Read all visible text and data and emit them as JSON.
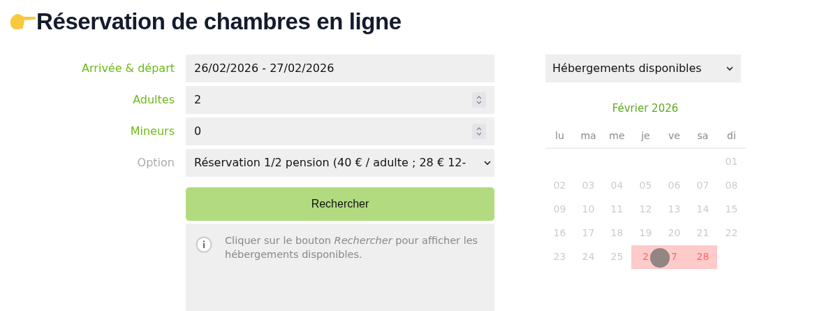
{
  "title": "Réservation de chambres en ligne",
  "form": {
    "fields": [
      {
        "label": "Arrivée & départ",
        "kind": "text",
        "value": "26/02/2026 - 27/02/2026",
        "required": true
      },
      {
        "label": "Adultes",
        "kind": "number",
        "value": "2",
        "required": true
      },
      {
        "label": "Mineurs",
        "kind": "number",
        "value": "0",
        "required": true
      },
      {
        "label": "Option",
        "kind": "select",
        "value": "Réservation 1/2 pension (40 € / adulte ; 28 € 12-",
        "required": false
      }
    ],
    "search_button": "Rechercher",
    "info_message": "Cliquer sur le bouton *Rechercher* pour afficher les hébergements disponibles."
  },
  "filter_select": "Hébergements disponibles",
  "calendar": {
    "month": "Février 2026",
    "weekdays": [
      "lu",
      "ma",
      "me",
      "je",
      "ve",
      "sa",
      "di"
    ],
    "weeks": [
      {
        "days": [
          {
            "label": "01",
            "selected": false
          }
        ]
      },
      {
        "days": [
          {
            "label": "02",
            "selected": false
          },
          {
            "label": "03",
            "selected": false
          },
          {
            "label": "04",
            "selected": false
          },
          {
            "label": "05",
            "selected": false
          },
          {
            "label": "06",
            "selected": false
          },
          {
            "label": "07",
            "selected": false
          },
          {
            "label": "08",
            "selected": false
          }
        ]
      },
      {
        "days": [
          {
            "label": "09",
            "selected": false
          },
          {
            "label": "10",
            "selected": false
          },
          {
            "label": "11",
            "selected": false
          },
          {
            "label": "12",
            "selected": false
          },
          {
            "label": "13",
            "selected": false
          },
          {
            "label": "14",
            "selected": false
          },
          {
            "label": "15",
            "selected": false
          }
        ]
      },
      {
        "days": [
          {
            "label": "16",
            "selected": false
          },
          {
            "label": "17",
            "selected": false
          },
          {
            "label": "18",
            "selected": false
          },
          {
            "label": "19",
            "selected": false
          },
          {
            "label": "20",
            "selected": false
          },
          {
            "label": "21",
            "selected": false
          },
          {
            "label": "22",
            "selected": false
          }
        ]
      },
      {
        "days": [
          {
            "label": "23",
            "selected": false
          },
          {
            "label": "24",
            "selected": false
          },
          {
            "label": "25",
            "selected": false
          },
          {
            "label": "2",
            "selected": true
          },
          {
            "label": "7",
            "selected": true
          },
          {
            "label": "28",
            "selected": true
          }
        ]
      }
    ]
  }
}
